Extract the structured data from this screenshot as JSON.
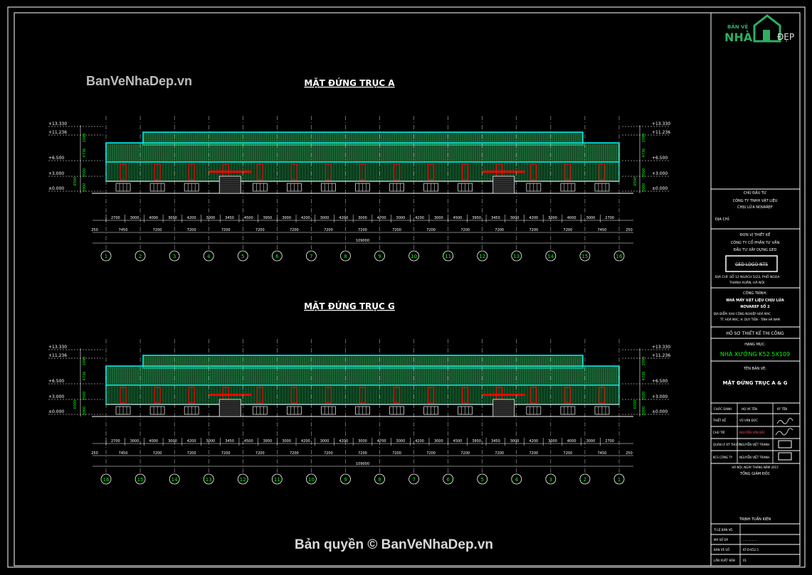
{
  "watermark_top": "BanVeNhaDep.vn",
  "watermark_bottom": "Bản quyền © BanVeNhaDep.vn",
  "logo": {
    "line1": "BẢN VẼ",
    "line2": "NHÀ",
    "line3": "ĐẸP"
  },
  "elevations": [
    {
      "title": "MẶT ĐỨNG TRỤC A",
      "levels_left": [
        "+13.330",
        "+11.236",
        "+6.500",
        "+3.000",
        "±0.000"
      ],
      "levels_right": [
        "+13.330",
        "+11.236",
        "+6.500",
        "+3.000",
        "±0.000"
      ],
      "vert_dims": [
        "2094",
        "4736",
        "3500",
        "3000"
      ],
      "dims_top": [
        "2700",
        "3000",
        "4000",
        "3000",
        "4200",
        "3000",
        "3450",
        "4500",
        "3950",
        "3000",
        "4200",
        "3000",
        "4200",
        "3000",
        "4700",
        "3000",
        "4200",
        "3000",
        "4500",
        "3950",
        "3450",
        "3000",
        "4200",
        "3000",
        "4000",
        "3000",
        "2700"
      ],
      "dims_mid": [
        "250",
        "7450",
        "7200",
        "7200",
        "7200",
        "7200",
        "7200",
        "7200",
        "7200",
        "7200",
        "7200",
        "7200",
        "7200",
        "7200",
        "7200",
        "7450",
        "250"
      ],
      "total": "109000",
      "axes": [
        "1",
        "2",
        "3",
        "4",
        "5",
        "6",
        "7",
        "8",
        "9",
        "10",
        "11",
        "12",
        "13",
        "14",
        "15",
        "16"
      ]
    },
    {
      "title": "MẶT ĐỨNG TRỤC G",
      "levels_left": [
        "+13.330",
        "+11.236",
        "+6.500",
        "+3.000",
        "±0.000"
      ],
      "levels_right": [
        "+13.330",
        "+11.236",
        "+6.500",
        "+3.000",
        "±0.000"
      ],
      "vert_dims": [
        "2094",
        "4736",
        "3500",
        "3000"
      ],
      "dims_top": [
        "2700",
        "3000",
        "4000",
        "3000",
        "4200",
        "3000",
        "3450",
        "4500",
        "3950",
        "3000",
        "4200",
        "3000",
        "4200",
        "3000",
        "4700",
        "3000",
        "4200",
        "3000",
        "4500",
        "3950",
        "3450",
        "3000",
        "4200",
        "3000",
        "4000",
        "3000",
        "2700"
      ],
      "dims_mid": [
        "250",
        "7450",
        "7200",
        "7200",
        "7200",
        "7200",
        "7200",
        "7200",
        "7200",
        "7200",
        "7200",
        "7200",
        "7200",
        "7200",
        "7200",
        "7450",
        "250"
      ],
      "total": "109000",
      "axes": [
        "16",
        "15",
        "14",
        "13",
        "12",
        "11",
        "10",
        "9",
        "8",
        "7",
        "6",
        "5",
        "4",
        "3",
        "2",
        "1"
      ]
    }
  ],
  "title_block": {
    "owner_label": "CHỦ ĐẦU TƯ",
    "owner_name": "CÔNG TY TNHH VẬT LIỆU",
    "owner_name2": "CHỊU LỬA NOVAREF",
    "owner_addr": "ĐỊA CHỈ:",
    "designer_label": "ĐƠN VỊ THIẾT KẾ",
    "designer_name": "CÔNG TY CỔ PHẦN TƯ VẤN",
    "designer_name2": "ĐẦU TƯ XÂY DỰNG GED",
    "designer_logo": "GED LOGO NTS",
    "designer_addr": "ĐỊA CHỈ: SỐ 12 NGÁCH 5/23, PHỐ NGOẠ",
    "designer_addr2": "THANH XUÂN, HÀ NỘI",
    "project_label": "CÔNG TRÌNH:",
    "project_name": "NHÀ MÁY VẬT LIỆU CHỊU LỬA",
    "project_name2": "NOVAREF SỐ 2",
    "project_loc": "ĐỊA ĐIỂM: KHU CÔNG NGHIỆP HOÀ MẠC",
    "project_loc2": "TT. HOÀ MẠC, H. DUY TIÊN - TỈNH HÀ NAM",
    "phase": "HỒ SƠ THIẾT KẾ THI CÔNG",
    "item_label": "HẠNG MỤC:",
    "item_name": "NHÀ XƯỞNG K52.5X109",
    "drawing_label": "TÊN BẢN VẼ:",
    "drawing_name": "MẶT ĐỨNG TRỤC A & G",
    "sig_header": [
      "CHỨC DANH",
      "HỌ VÀ TÊN",
      "KÝ TÊN"
    ],
    "sig_rows": [
      [
        "THIẾT KẾ",
        "VŨ VĂN ĐỨC"
      ],
      [
        "CHỦ TRÌ",
        "NGUYỄN VĂN BẮC"
      ],
      [
        "QUẢN LÝ KỸ THUẬT",
        "NGUYỄN VIỆT TRANH"
      ],
      [
        "KCS CÔNG TY",
        "NGUYỄN VIỆT TRANH"
      ]
    ],
    "date_line": "HÀ NỘI, NGÀY    THÁNG    NĂM 2015",
    "director_label": "TỔNG GIÁM ĐỐC",
    "director_name": "TRỊNH TUẤN KIÊN",
    "bottom_rows": [
      [
        "TỈ LỆ BẢN VẼ:",
        ""
      ],
      [
        "MÃ SỐ DP",
        "................"
      ],
      [
        "BẢN VẼ SỐ",
        "KT-D-K52.5"
      ],
      [
        "LẦN XUẤT BẢN",
        "01"
      ]
    ]
  },
  "colors": {
    "frame": "#ffffff",
    "cyan": "#00ffff",
    "green": "#00ff00",
    "red": "#ff0000",
    "roof": "#1f7a3d"
  }
}
